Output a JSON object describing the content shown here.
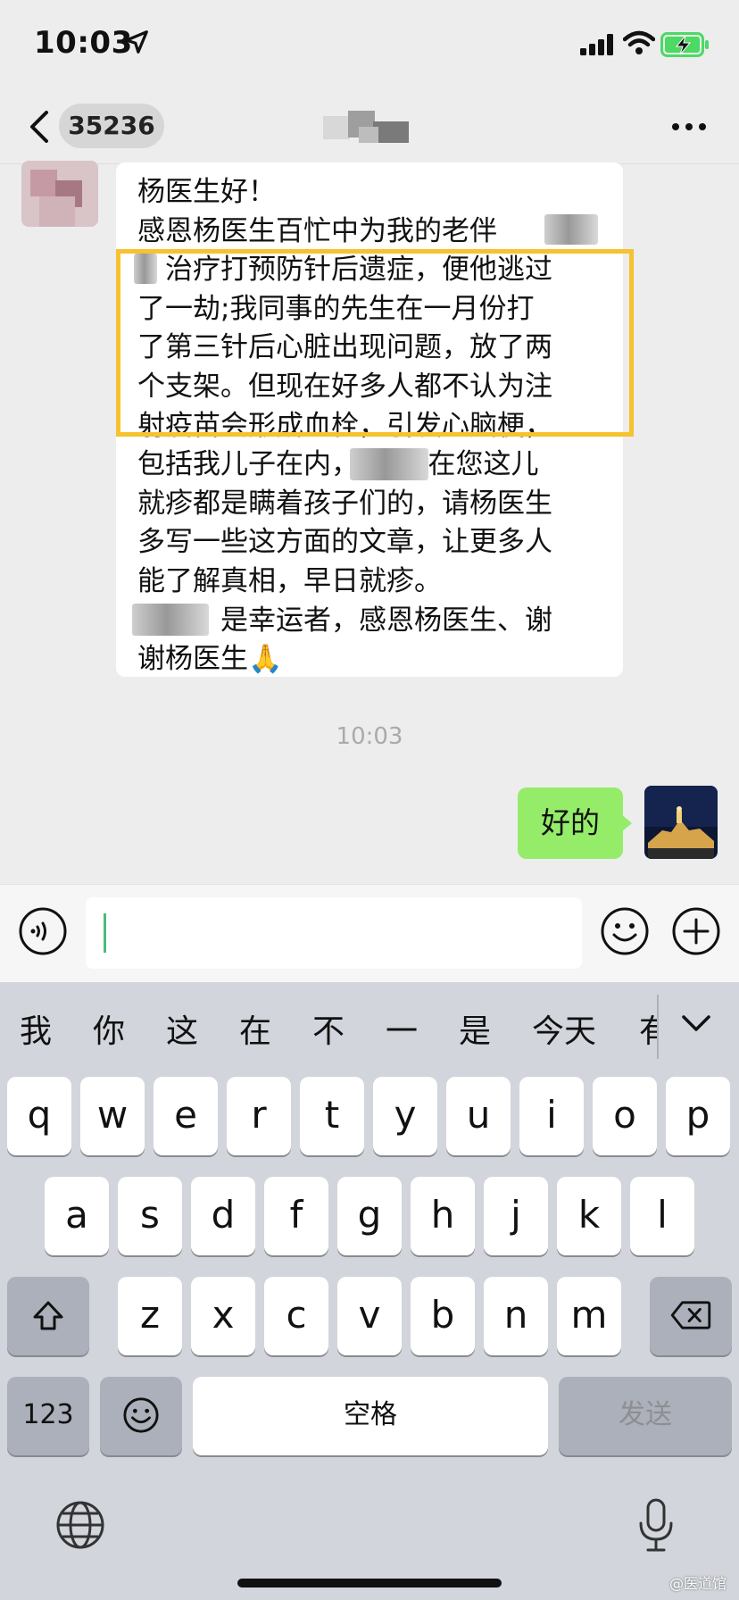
{
  "status_bar": {
    "time": "10:03",
    "icons": [
      "location-arrow-icon",
      "signal-icon",
      "wifi-icon",
      "battery-charging-icon"
    ]
  },
  "nav": {
    "unread_count": "35236",
    "more_icon": "more-dots-icon"
  },
  "chat": {
    "incoming_message": "杨医生好！\n感恩杨医生百忙中为我的老伴\n　治疗打预防针后遗症，便他逃过\n了一劫;我同事的先生在一月份打\n了第三针后心脏出现问题，放了两\n个支架。但现在好多人都不认为注\n射疫苗会形成血栓，引发心脑梗，\n包括我儿子在内，　　　在您这儿\n就疹都是瞒着孩子们的，请杨医生\n多写一些这方面的文章，让更多人\n能了解真相，早日就疹。\n　　　是幸运者，感恩杨医生、谢\n谢杨医生🙏",
    "timestamp": "10:03",
    "outgoing_message": "好的",
    "highlight_color": "#f6c230",
    "outgoing_bubble_color": "#95ec69"
  },
  "input_bar": {
    "value": "",
    "icons": [
      "voice-icon",
      "emoji-icon",
      "plus-icon"
    ]
  },
  "keyboard": {
    "suggestions": [
      "我",
      "你",
      "这",
      "在",
      "不",
      "一",
      "是",
      "今天",
      "有"
    ],
    "row1": [
      "q",
      "w",
      "e",
      "r",
      "t",
      "y",
      "u",
      "i",
      "o",
      "p"
    ],
    "row2": [
      "a",
      "s",
      "d",
      "f",
      "g",
      "h",
      "j",
      "k",
      "l"
    ],
    "row3": [
      "z",
      "x",
      "c",
      "v",
      "b",
      "n",
      "m"
    ],
    "numbers_label": "123",
    "space_label": "空格",
    "send_label": "发送"
  },
  "watermark": "@医道馆"
}
